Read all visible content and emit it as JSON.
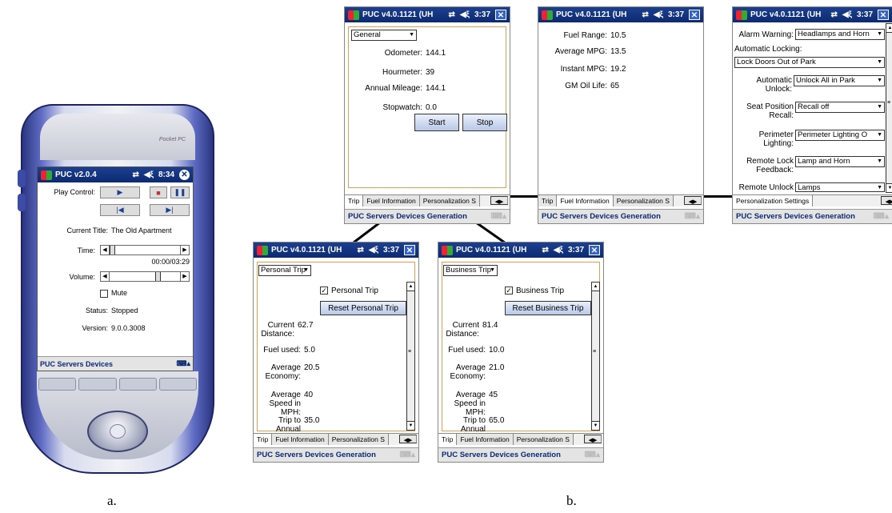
{
  "device_a": {
    "brand": "Pocket PC",
    "title": "PUC v2.0.4",
    "clock": "8:34",
    "play_control_label": "Play Control:",
    "current_title_label": "Current Title:",
    "current_title_value": "The Old Apartment",
    "time_label": "Time:",
    "time_value": "00:00/03:29",
    "time_fraction": 0.0,
    "volume_label": "Volume:",
    "volume_fraction": 0.7,
    "mute_label": "Mute",
    "mute_checked": false,
    "status_label": "Status:",
    "status_value": "Stopped",
    "version_label": "Version:",
    "version_value": "9.0.0.3008",
    "menubar": "PUC Servers Devices"
  },
  "common": {
    "title": "PUC v4.0.1121 (UH",
    "clock": "3:37",
    "menubar": "PUC Servers Devices Generation",
    "tabs": [
      "Trip",
      "Fuel Information",
      "Personalization S"
    ]
  },
  "screen_general": {
    "dropdown": "General",
    "odometer_label": "Odometer:",
    "odometer_value": "144.1",
    "hourmeter_label": "Hourmeter:",
    "hourmeter_value": "39",
    "annual_mileage_label": "Annual Mileage:",
    "annual_mileage_value": "144.1",
    "stopwatch_label": "Stopwatch:",
    "stopwatch_value": "0.0",
    "start": "Start",
    "stop": "Stop"
  },
  "screen_fuel": {
    "fuel_range_label": "Fuel Range:",
    "fuel_range_value": "10.5",
    "avg_mpg_label": "Average MPG:",
    "avg_mpg_value": "13.5",
    "instant_mpg_label": "Instant MPG:",
    "instant_mpg_value": "19.2",
    "oil_label": "GM Oil Life:",
    "oil_value": "65"
  },
  "screen_personalization": {
    "alarm_label": "Alarm Warning:",
    "alarm_value": "Headlamps and Horn",
    "auto_lock_label": "Automatic Locking:",
    "auto_lock_value": "Lock Doors Out of Park",
    "auto_unlock_label": "Automatic Unlock:",
    "auto_unlock_value": "Unlock All in Park",
    "seat_label": "Seat Position Recall:",
    "seat_value": "Recall off",
    "perimeter_label": "Perimeter Lighting:",
    "perimeter_value": "Perimeter Lighting O",
    "remote_lock_label": "Remote Lock Feedback:",
    "remote_lock_value": "Lamp and Horn",
    "remote_unlock_label": "Remote Unlock",
    "remote_unlock_value": "Lamps",
    "tab": "Personalization Settings"
  },
  "screen_personal": {
    "dropdown": "Personal Trip",
    "checkbox": "Personal Trip",
    "reset": "Reset Personal Trip",
    "distance_label": "Current Distance:",
    "distance_value": "62.7",
    "fuel_label": "Fuel used:",
    "fuel_value": "5.0",
    "economy_label": "Average Economy:",
    "economy_value": "20.5",
    "speed_label": "Average Speed in MPH:",
    "speed_value": "40",
    "annual_label": "Trip to Annual",
    "annual_value": "35.0"
  },
  "screen_business": {
    "dropdown": "Business Trip",
    "checkbox": "Business Trip",
    "reset": "Reset Business Trip",
    "distance_label": "Current Distance:",
    "distance_value": "81.4",
    "fuel_label": "Fuel used:",
    "fuel_value": "10.0",
    "economy_label": "Average Economy:",
    "economy_value": "21.0",
    "speed_label": "Average Speed in MPH:",
    "speed_value": "45",
    "annual_label": "Trip to Annual",
    "annual_value": "65.0"
  },
  "captions": {
    "a": "a.",
    "b": "b."
  }
}
